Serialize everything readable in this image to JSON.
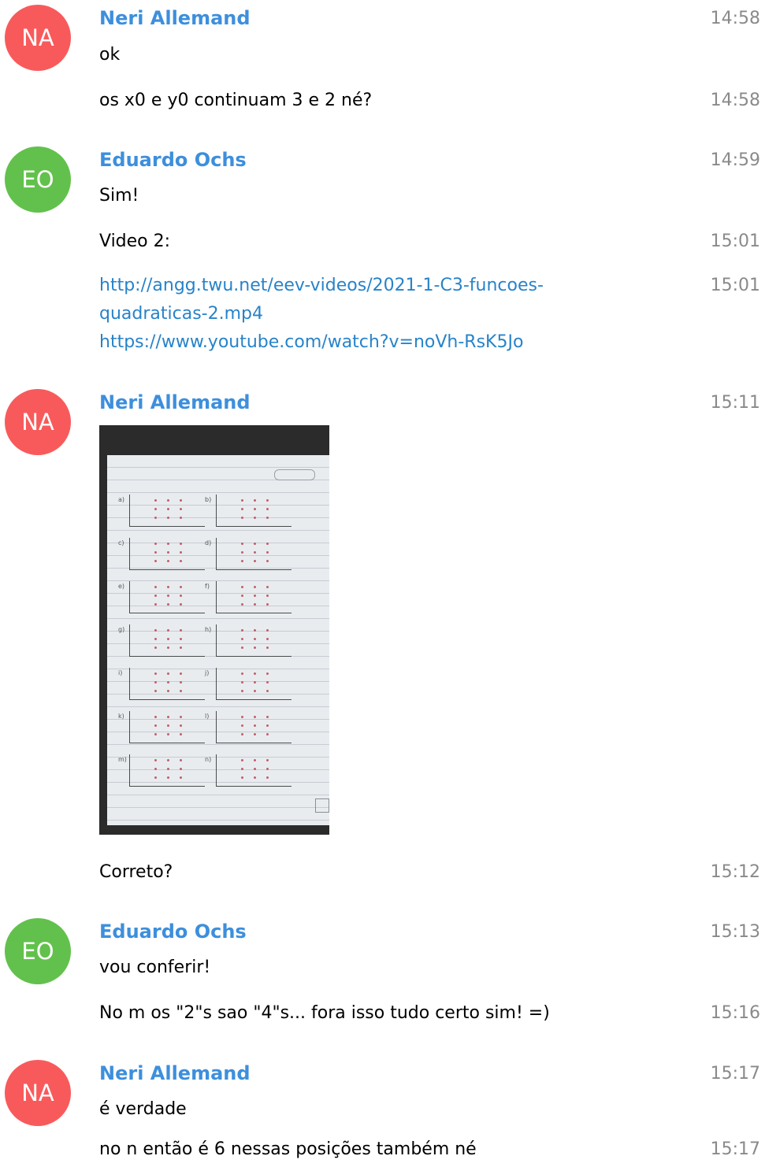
{
  "messages": [
    {
      "avatar": "NA",
      "author": "Neri Allemand",
      "text": "ok",
      "time": "14:58"
    },
    {
      "text": "os x0 e y0 continuam 3 e 2 né?",
      "time": "14:58"
    },
    {
      "avatar": "EO",
      "author": "Eduardo Ochs",
      "text": "Sim!",
      "time": "14:59"
    },
    {
      "text": "Video 2:",
      "time": "15:01"
    },
    {
      "link_line1": "http://angg.twu.net/eev-videos/2021-1-C3-funcoes-",
      "link_line2": "quadraticas-2.mp4",
      "link2": "https://www.youtube.com/watch?v=noVh-RsK5Jo",
      "time": "15:01"
    },
    {
      "avatar": "NA",
      "author": "Neri Allemand",
      "time": "15:11"
    },
    {
      "text": "Correto?",
      "time": "15:12"
    },
    {
      "avatar": "EO",
      "author": "Eduardo Ochs",
      "text": "vou conferir!",
      "time": "15:13"
    },
    {
      "text": "No m os \"2\"s sao \"4\"s... fora isso tudo certo sim! =)",
      "time": "15:16"
    },
    {
      "avatar": "NA",
      "author": "Neri Allemand",
      "text": "é verdade",
      "time": "15:17"
    },
    {
      "text": "no n então é 6 nessas posições também né",
      "time": "15:17"
    }
  ],
  "photo": {
    "labels_left": [
      "a)",
      "c)",
      "e)",
      "g)",
      "i)",
      "k)",
      "m)"
    ],
    "labels_right": [
      "b)",
      "d)",
      "f)",
      "h)",
      "j)",
      "l)",
      "n)"
    ]
  },
  "colors": {
    "avatar_na": "#f85a5b",
    "avatar_eo": "#62c14c",
    "author_name": "#3d8fdc",
    "link": "#2783c9",
    "timestamp": "#8a8a8a"
  }
}
